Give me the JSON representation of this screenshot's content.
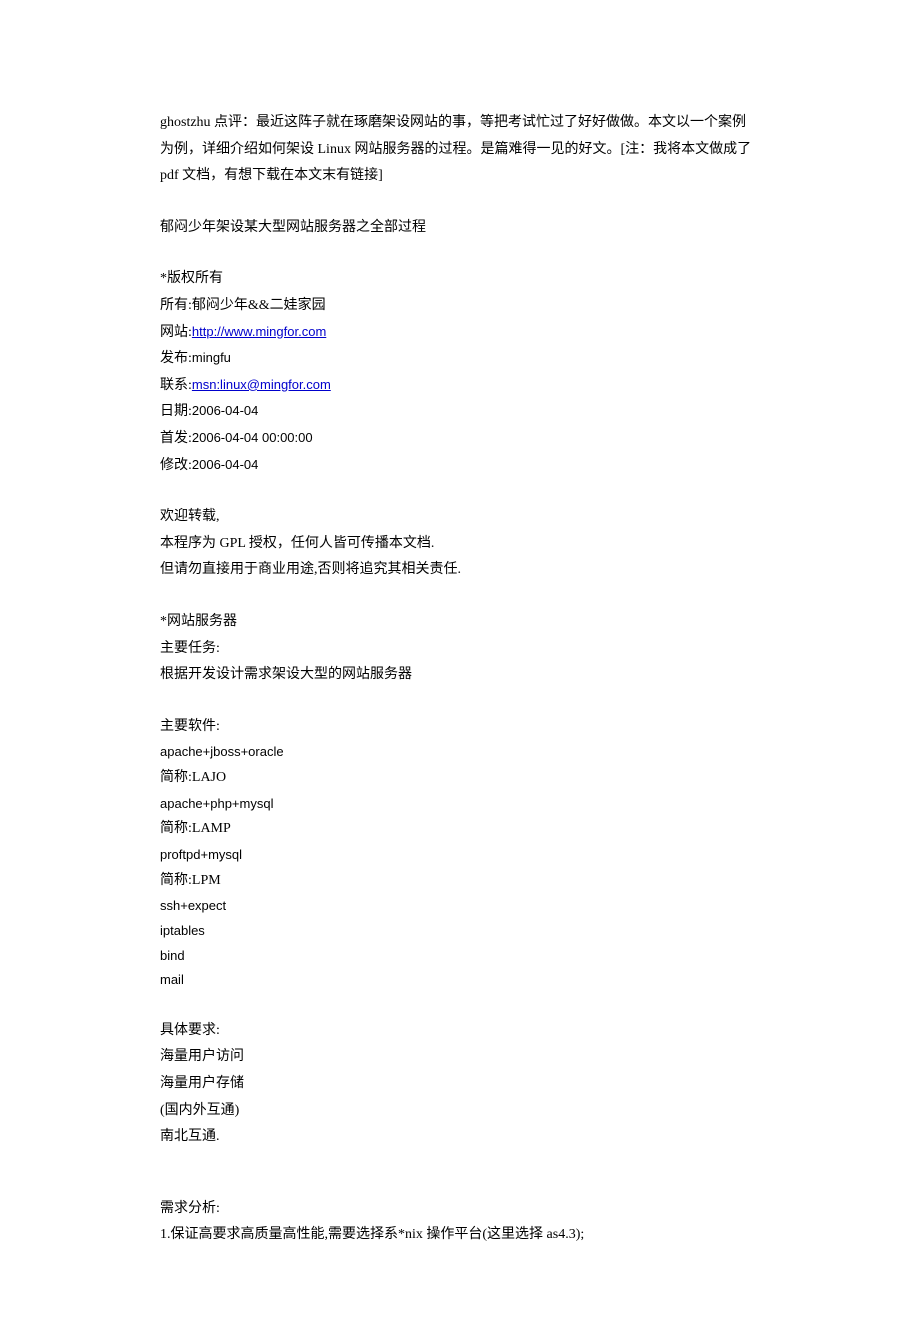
{
  "intro": {
    "line1": "ghostzhu 点评：最近这阵子就在琢磨架设网站的事，等把考试忙过了好好做做。本文以一个案例为例，详细介绍如何架设 Linux 网站服务器的过程。是篇难得一见的好文。[注：我将本文做成了 pdf 文档，有想下载在本文末有链接]"
  },
  "title": "郁闷少年架设某大型网站服务器之全部过程",
  "copyright": {
    "header": "*版权所有",
    "owner": "所有:郁闷少年&&二娃家园",
    "site_label": "网站:",
    "site_url": "http://www.mingfor.com",
    "publisher_label": "发布:",
    "publisher": "mingfu",
    "contact_label": "联系:",
    "contact_url": "msn:linux@mingfor.com",
    "date_label": "日期:",
    "date_value": "2006-04-04",
    "first_label": "首发:",
    "first_value": "2006-04-04 00:00:00",
    "modified_label": "修改:",
    "modified_value": "2006-04-04"
  },
  "license": {
    "line1": "欢迎转载,",
    "line2": "本程序为 GPL 授权，任何人皆可传播本文档.",
    "line3": "但请勿直接用于商业用途,否则将追究其相关责任."
  },
  "server": {
    "header": "*网站服务器",
    "task_label": "主要任务:",
    "task_desc": "根据开发设计需求架设大型的网站服务器"
  },
  "software": {
    "header": "主要软件:",
    "items": [
      "apache+jboss+oracle",
      "简称:LAJO",
      "apache+php+mysql",
      "简称:LAMP",
      "proftpd+mysql",
      "简称:LPM",
      "ssh+expect",
      "iptables",
      "bind",
      "mail"
    ]
  },
  "requirements": {
    "header": "具体要求:",
    "items": [
      "海量用户访问",
      "海量用户存储",
      "(国内外互通)",
      "南北互通."
    ]
  },
  "analysis": {
    "header": "需求分析:",
    "item1": "1.保证高要求高质量高性能,需要选择系*nix 操作平台(这里选择 as4.3);"
  }
}
